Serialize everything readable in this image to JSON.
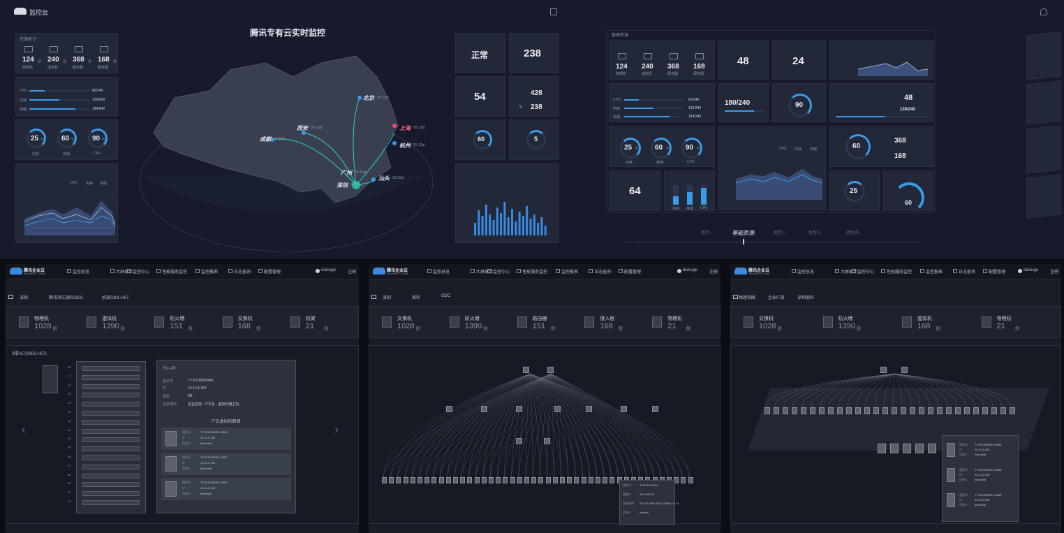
{
  "top": {
    "app_name": "监控云",
    "title": "腾讯专有云实时监控",
    "left": {
      "res_section": "资源统计",
      "res_items": [
        {
          "v": "124",
          "u": "台",
          "l": "物理机"
        },
        {
          "v": "240",
          "u": "台",
          "l": "虚拟机"
        },
        {
          "v": "368",
          "u": "台",
          "l": "服务器"
        },
        {
          "v": "168",
          "u": "台",
          "l": "服务器"
        }
      ],
      "alloc_items": [
        {
          "k": "CPU",
          "v": "60/240"
        },
        {
          "k": "内存",
          "v": "120/240"
        },
        {
          "k": "存储",
          "v": "184/240"
        }
      ],
      "usage_rings": [
        {
          "v": "25",
          "u": "%",
          "l": "内存"
        },
        {
          "v": "60",
          "u": "%",
          "l": "存储"
        },
        {
          "v": "90",
          "u": "%",
          "l": "CPU"
        }
      ],
      "legend": [
        "CPU",
        "内存",
        "存储"
      ]
    },
    "map": {
      "cities": [
        {
          "n": "北京",
          "t": "09:12pt"
        },
        {
          "n": "上海",
          "t": "09:12pt"
        },
        {
          "n": "杭州",
          "t": "09:12pt"
        },
        {
          "n": "西安",
          "t": "09:12pt"
        },
        {
          "n": "成都",
          "t": "09:12pt"
        },
        {
          "n": "广州",
          "t": "09:12pt"
        },
        {
          "n": "汕头",
          "t": "09:12pt"
        },
        {
          "n": "深圳",
          "t": "09:12pt"
        }
      ]
    },
    "right": {
      "status": "正常",
      "n1": "238",
      "n2": "54",
      "n3": "428",
      "n4": "238",
      "n4_label": "TB",
      "ring1": "60",
      "ring1_u": "%",
      "ring2": "5",
      "ring2_u": "%"
    },
    "dash2": {
      "section": "基础资源",
      "res_items": [
        {
          "v": "124",
          "u": "台",
          "l": "物理机"
        },
        {
          "v": "240",
          "u": "台",
          "l": "虚拟机"
        },
        {
          "v": "368",
          "u": "台",
          "l": "服务器"
        },
        {
          "v": "168",
          "u": "台",
          "l": "服务器"
        }
      ],
      "n48": "48",
      "n24": "24",
      "frac": "180/240",
      "ring90": "90",
      "r48": "48",
      "r128": "128/240",
      "rings": [
        {
          "v": "25",
          "u": "%",
          "l": "内存"
        },
        {
          "v": "60",
          "u": "%",
          "l": "存储"
        },
        {
          "v": "90",
          "u": "%",
          "l": "CPU"
        }
      ],
      "ring60": "60",
      "n368": "368",
      "n168": "168",
      "n64": "64",
      "r25": "25",
      "r60b": "60",
      "bars_labels": [
        "内存",
        "存储",
        "CPU"
      ],
      "legend": [
        "CPU",
        "内存",
        "存储"
      ],
      "tabs": [
        "类型一",
        "基础资源",
        "类型二",
        "类型三",
        "类型四"
      ]
    }
  },
  "bot": {
    "logo_name": "腾讯企业云",
    "logo_sub": "Tencent IT Cloud",
    "nav": [
      "监控总览",
      "大屏展示",
      "监控中心",
      "性能服务监控",
      "监控报表",
      "日志查询",
      "配置管理"
    ],
    "user": "daisuge",
    "logout": "注销",
    "s1": {
      "crumbs": [
        "深圳",
        "腾讯滨江南科ODC",
        "机架0301-H07"
      ],
      "stats": [
        {
          "l": "物理机",
          "v": "1028",
          "u": "台"
        },
        {
          "l": "虚拟机",
          "v": "1390",
          "u": "台"
        },
        {
          "l": "防火墙",
          "v": "151",
          "u": "台"
        },
        {
          "l": "交换机",
          "v": "168",
          "u": "台"
        },
        {
          "l": "机架",
          "v": "21",
          "u": "台"
        }
      ],
      "rack_title": "3楼#17(0301-H07)",
      "slots": [
        "18",
        "17",
        "16",
        "15",
        "14",
        "13",
        "12",
        "11",
        "10",
        "09",
        "08",
        "07",
        "06",
        "05",
        "04",
        "03"
      ],
      "info": {
        "no": "No.40",
        "fields": [
          {
            "k": "固资号",
            "v": "TYSV18092AAK"
          },
          {
            "k": "IP",
            "v": "10.14.8.159"
          },
          {
            "k": "机型",
            "v": "M1"
          },
          {
            "k": "业务模块",
            "v": "企业应用 - IT平台 - 虚拟化宿主机"
          }
        ],
        "vm_title": "IT云虚拟机器源",
        "vms": [
          {
            "a": "TYSV12090FK-VM05",
            "b": "10.14.2.109",
            "c": "bobochai"
          },
          {
            "a": "TYSV12090FK-VM05",
            "b": "10.14.2.109",
            "c": "bobochai"
          },
          {
            "a": "TYSV12090FK-VM05",
            "b": "10.14.2.109",
            "c": "bobochai"
          }
        ],
        "vm_keys": [
          "固资号",
          "IP",
          "负责人"
        ]
      }
    },
    "s2": {
      "crumbs": [
        "深圳",
        "南科",
        "ODC"
      ],
      "stats": [
        {
          "l": "交换机",
          "v": "1028",
          "u": "台"
        },
        {
          "l": "防火墙",
          "v": "1390",
          "u": "台"
        },
        {
          "l": "路由器",
          "v": "151",
          "u": "台"
        },
        {
          "l": "接入层",
          "v": "168",
          "u": "台"
        },
        {
          "l": "物理机",
          "v": "21",
          "u": "台"
        }
      ],
      "tip": [
        {
          "k": "固资号",
          "v": "TYNT1207004"
        },
        {
          "k": "管理IP",
          "v": "10.14.60.26"
        },
        {
          "k": "设备名称",
          "v": "SZ-GK-0301-G03-C6509-LC-01"
        },
        {
          "k": "负责人",
          "v": "cimneu"
        }
      ]
    },
    "s3": {
      "crumbs": [
        "物理视图",
        "企业IT部",
        "深圳南科"
      ],
      "stats": [
        {
          "l": "交换机",
          "v": "1028",
          "u": "台"
        },
        {
          "l": "防火墙",
          "v": "1390",
          "u": "台"
        },
        {
          "l": "虚拟机",
          "v": "168",
          "u": "台"
        },
        {
          "l": "物理机",
          "v": "21",
          "u": "台"
        }
      ],
      "vms": [
        {
          "a": "TYSV12090FK-VM05",
          "b": "10.14.3.108",
          "c": "bobochai"
        },
        {
          "a": "TYSV12090FK-VM05",
          "b": "10.14.3.108",
          "c": "bobochai"
        },
        {
          "a": "TYSV12090FK-VM05",
          "b": "10.14.3.108",
          "c": "bobochai"
        }
      ]
    }
  }
}
